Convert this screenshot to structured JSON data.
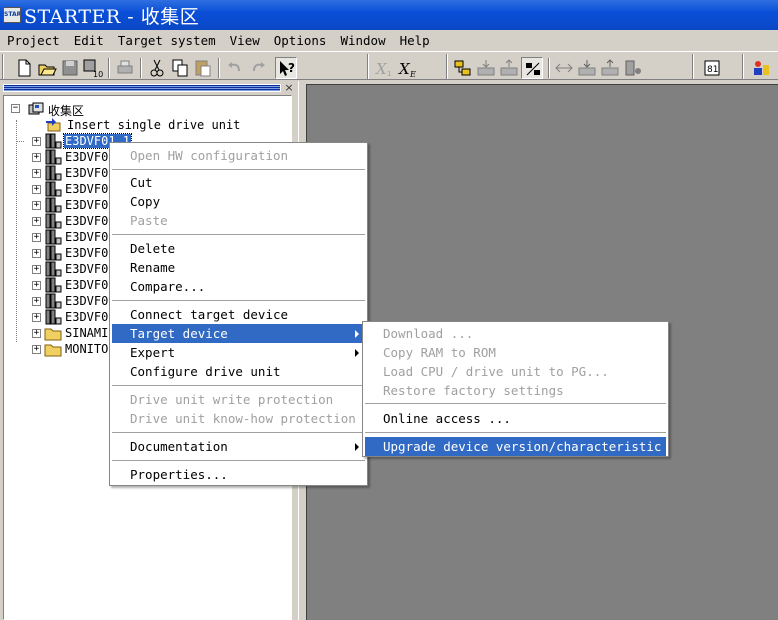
{
  "window": {
    "icon_text": "STARTER",
    "title": "STARTER - 收集区"
  },
  "menubar": [
    "Project",
    "Edit",
    "Target system",
    "View",
    "Options",
    "Window",
    "Help"
  ],
  "tree": {
    "root": "收集区",
    "insert_label": "Insert single drive unit",
    "drives": [
      "E3DVF01_1",
      "E3DVF0",
      "E3DVF0",
      "E3DVF0",
      "E3DVF0",
      "E3DVF0",
      "E3DVF0",
      "E3DVF0",
      "E3DVF0",
      "E3DVF0",
      "E3DVF0",
      "E3DVF0"
    ],
    "folders": [
      "SINAMIC",
      "MONITO"
    ]
  },
  "context_menu": {
    "items": [
      {
        "label": "Open HW configuration",
        "disabled": true
      },
      {
        "label": "Cut",
        "disabled": false
      },
      {
        "label": "Copy",
        "disabled": false
      },
      {
        "label": "Paste",
        "disabled": true
      },
      {
        "label": "Delete",
        "disabled": false
      },
      {
        "label": "Rename",
        "disabled": false
      },
      {
        "label": "Compare...",
        "disabled": false
      },
      {
        "label": "Connect target device",
        "disabled": false
      },
      {
        "label": "Target device",
        "disabled": false,
        "submenu": true,
        "highlighted": true
      },
      {
        "label": "Expert",
        "disabled": false,
        "submenu": true
      },
      {
        "label": "Configure drive unit",
        "disabled": false
      },
      {
        "label": "Drive unit write protection",
        "disabled": true
      },
      {
        "label": "Drive unit know-how protection",
        "disabled": true
      },
      {
        "label": "Documentation",
        "disabled": false,
        "submenu": true
      },
      {
        "label": "Properties...",
        "disabled": false
      }
    ]
  },
  "submenu": {
    "items": [
      {
        "label": "Download ...",
        "disabled": true
      },
      {
        "label": "Copy RAM to ROM",
        "disabled": true
      },
      {
        "label": "Load CPU / drive unit to PG...",
        "disabled": true
      },
      {
        "label": "Restore factory settings",
        "disabled": true
      },
      {
        "label": "Online access ...",
        "disabled": false
      },
      {
        "label": "Upgrade device version/characteristic",
        "disabled": false,
        "highlighted": true
      }
    ]
  },
  "colors": {
    "titlebar": "#0a47c4",
    "highlight": "#316ac5",
    "workspace": "#808080",
    "face": "#d4d0c8"
  }
}
